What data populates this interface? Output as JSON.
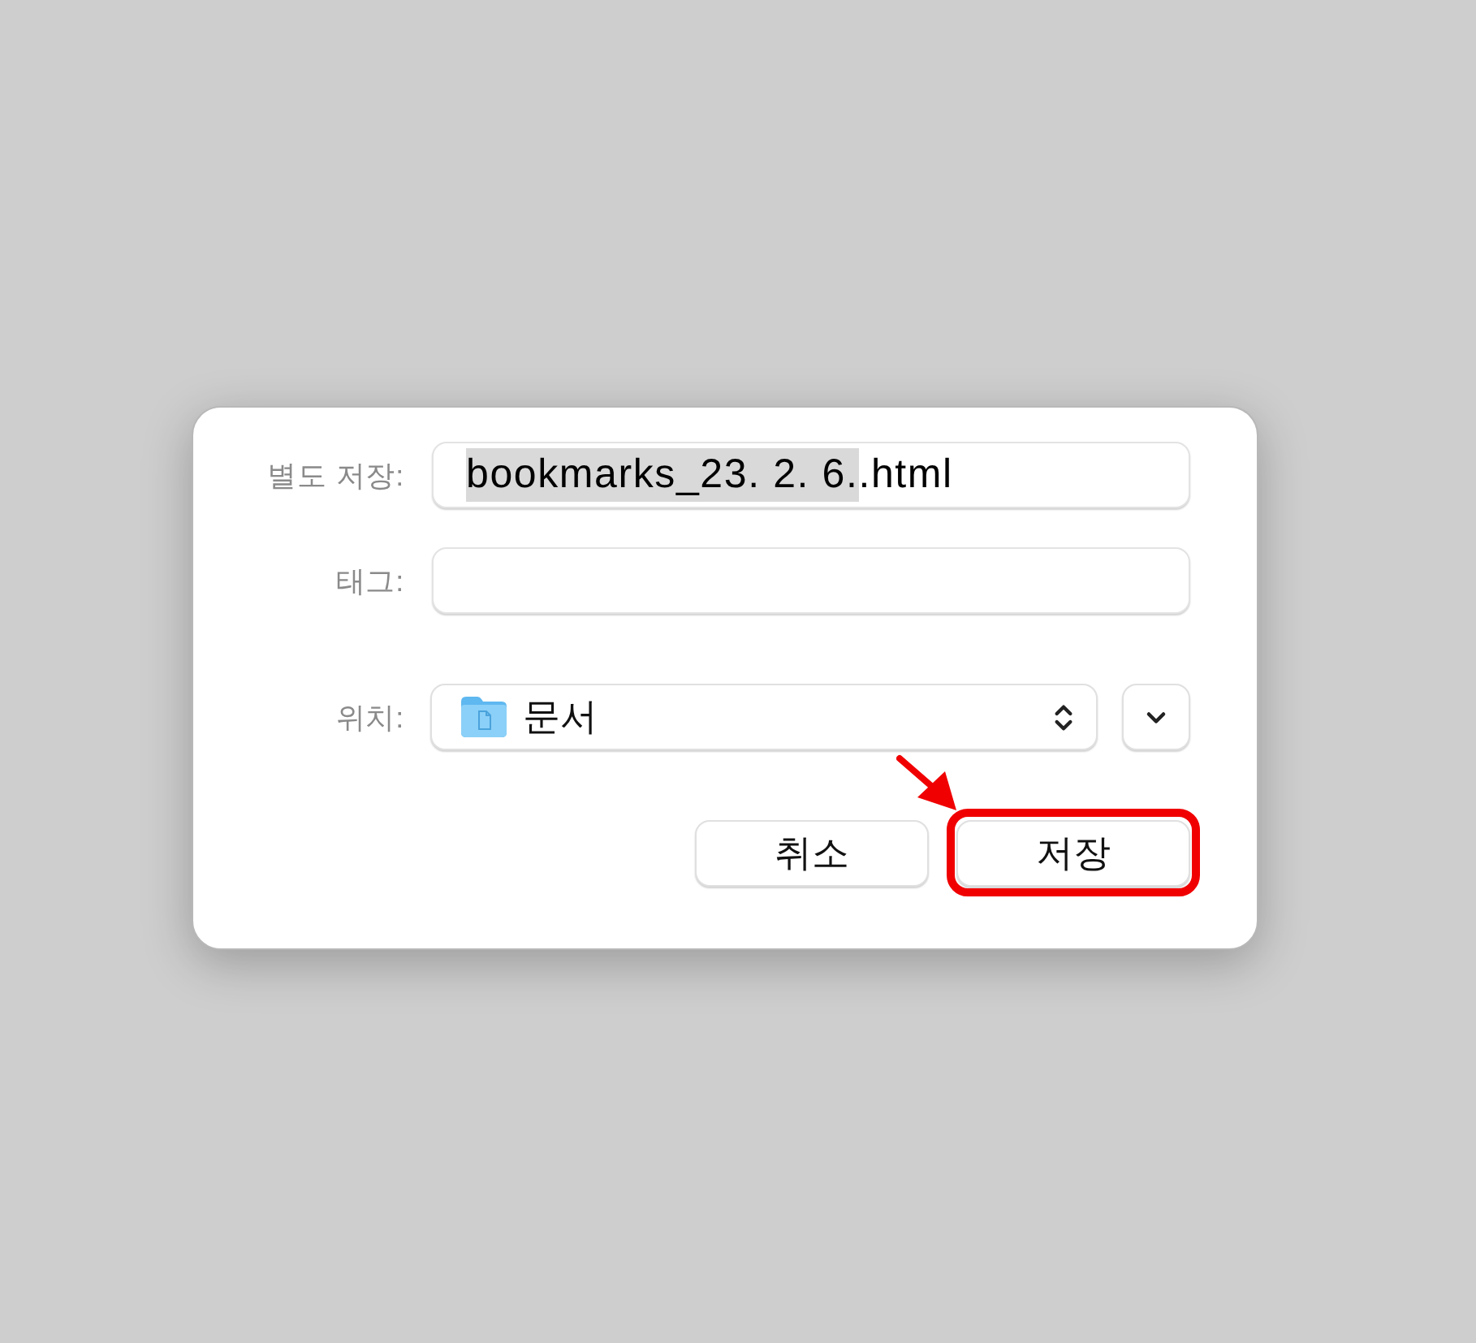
{
  "dialog": {
    "fields": [
      {
        "label": "별도 저장:",
        "value_parts": [
          {
            "text": "bookmarks_23. 2. 6.",
            "selected": true
          },
          {
            "text": ".html",
            "selected": false
          }
        ]
      },
      {
        "label": "태그:"
      }
    ],
    "location": {
      "label": "위치:",
      "value": "문서",
      "expanded": false
    },
    "buttons": [
      {
        "label": "취소",
        "highlighted": false
      },
      {
        "label": "저장",
        "highlighted": true
      }
    ]
  }
}
